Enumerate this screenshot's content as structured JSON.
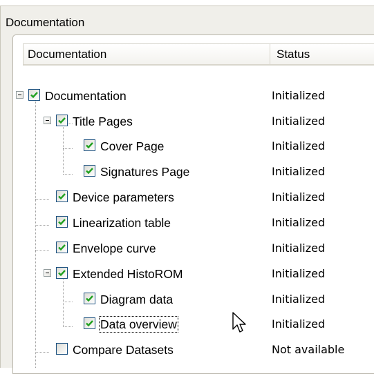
{
  "panel": {
    "title": "Documentation"
  },
  "tree": {
    "columns": {
      "name": "Documentation",
      "status": "Status"
    },
    "rows": [
      {
        "label": "Documentation",
        "status": "Initialized",
        "checked": true
      },
      {
        "label": "Title Pages",
        "status": "Initialized",
        "checked": true
      },
      {
        "label": "Cover Page",
        "status": "Initialized",
        "checked": true
      },
      {
        "label": "Signatures Page",
        "status": "Initialized",
        "checked": true
      },
      {
        "label": "Device parameters",
        "status": "Initialized",
        "checked": true
      },
      {
        "label": "Linearization table",
        "status": "Initialized",
        "checked": true
      },
      {
        "label": "Envelope curve",
        "status": "Initialized",
        "checked": true
      },
      {
        "label": "Extended HistoROM",
        "status": "Initialized",
        "checked": true
      },
      {
        "label": "Diagram data",
        "status": "Initialized",
        "checked": true
      },
      {
        "label": "Data overview",
        "status": "Initialized",
        "checked": true,
        "selected": true
      },
      {
        "label": "Compare Datasets",
        "status": "Not available",
        "checked": false
      }
    ]
  },
  "colors": {
    "checkmark": "#21a121",
    "checkbox_border": "#1c5180",
    "panel_bg": "#f0efea"
  }
}
